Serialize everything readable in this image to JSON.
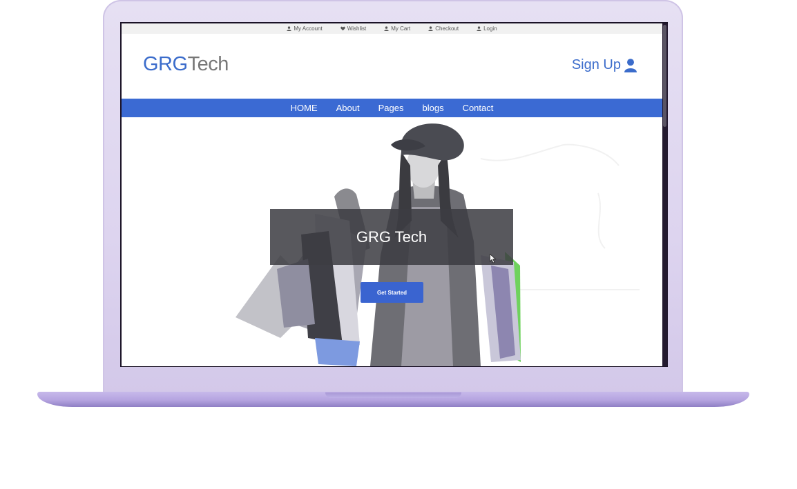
{
  "topbar": {
    "items": [
      {
        "label": "My Account",
        "icon": "user-icon"
      },
      {
        "label": "Wishlist",
        "icon": "heart-icon"
      },
      {
        "label": "My Cart",
        "icon": "user-icon"
      },
      {
        "label": "Checkout",
        "icon": "user-icon"
      },
      {
        "label": "Login",
        "icon": "user-icon"
      }
    ]
  },
  "header": {
    "logo_part1": "GRG",
    "logo_part2": "Tech",
    "signup_label": "Sign Up",
    "signup_icon": "user-icon"
  },
  "nav": {
    "items": [
      "HOME",
      "About",
      "Pages",
      "blogs",
      "Contact"
    ]
  },
  "hero": {
    "caption": "GRG Tech",
    "cta_label": "Get Started"
  },
  "colors": {
    "brand_blue": "#3b6ccb",
    "nav_blue": "#3b6ad3",
    "logo_grey": "#777777",
    "laptop_lavender": "#ddd4ef"
  }
}
